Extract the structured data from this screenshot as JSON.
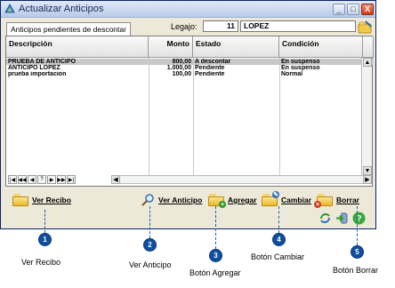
{
  "window": {
    "title": "Actualizar Anticipos",
    "minimize": "_",
    "maximize": "□",
    "close": "X"
  },
  "tab_label": "Anticipos pendientes de descontar",
  "legajo": {
    "label": "Legajo:",
    "value": "11",
    "name": "LOPEZ"
  },
  "grid": {
    "headers": [
      "Descripción",
      "Monto",
      "Estado",
      "Condición"
    ],
    "rows": [
      {
        "descripcion": "PRUEBA DE ANTICIPO",
        "monto": "800,00",
        "estado": "A descontar",
        "condicion": "En suspenso"
      },
      {
        "descripcion": "ANTICIPO LOPEZ",
        "monto": "1.000,00",
        "estado": "Pendiente",
        "condicion": "En suspenso"
      },
      {
        "descripcion": "prueba importacion",
        "monto": "100,00",
        "estado": "Pendiente",
        "condicion": "Normal"
      }
    ]
  },
  "nav_buttons": [
    "|◀",
    "◀◀",
    "◀",
    "?",
    "▶",
    "▶▶",
    "▶|"
  ],
  "actions": {
    "ver_recibo": "Ver Recibo",
    "ver_anticipo": "Ver Anticipo",
    "agregar": "Agregar",
    "cambiar": "Cambiar",
    "borrar": "Borrar"
  },
  "callouts": [
    {
      "num": "1",
      "caption": "Ver Recibo"
    },
    {
      "num": "2",
      "caption": "Ver Anticipo"
    },
    {
      "num": "3",
      "caption": "Botón Agregar"
    },
    {
      "num": "4",
      "caption": "Botón Cambiar"
    },
    {
      "num": "5",
      "caption": "Botón Borrar"
    }
  ],
  "colors": {
    "callout": "#0f4fa0",
    "selected_row": "#c8c8c8",
    "window_bg": "#ece9d8"
  }
}
